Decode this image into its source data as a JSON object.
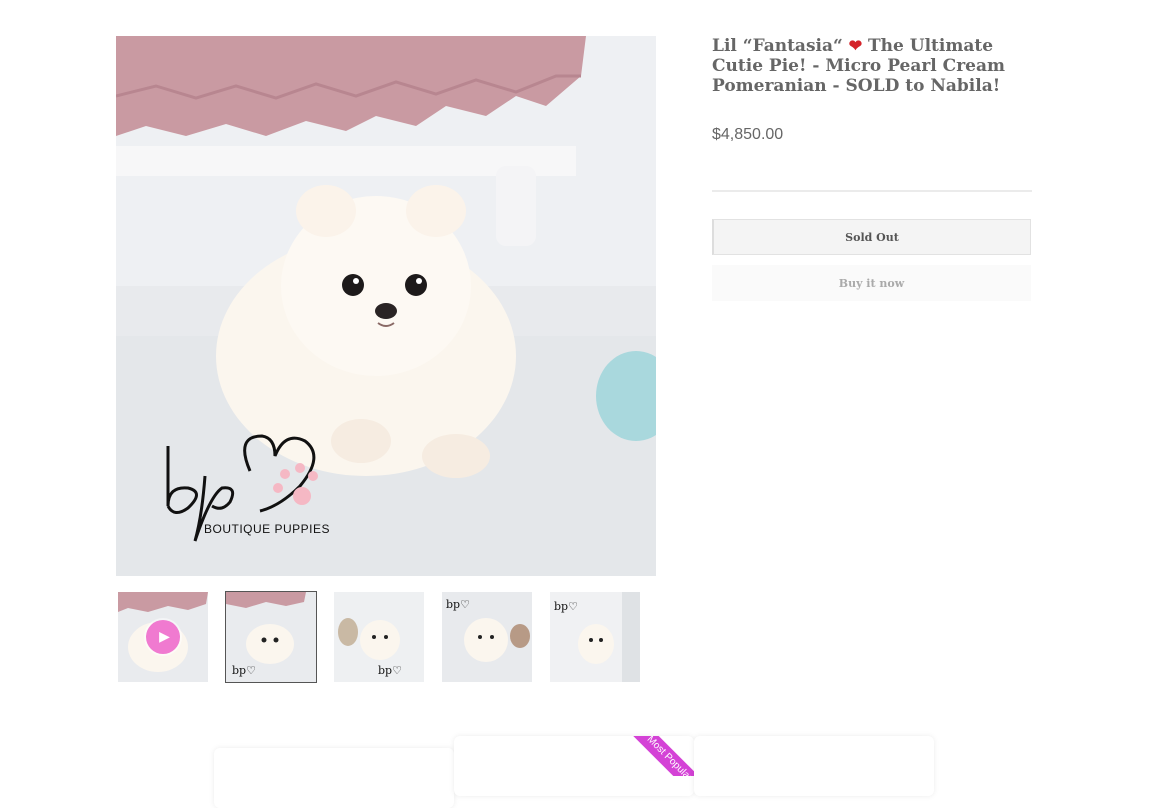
{
  "product": {
    "title": "Lil “Fantasia“ ",
    "title_rest": " The Ultimate Cutie Pie! - Micro Pearl Cream Pomeranian - SOLD to Nabila!",
    "emoji": "heart-emoji",
    "price": "$4,850.00"
  },
  "buttons": {
    "sold_out": "Sold Out",
    "buy_now": "Buy it now"
  },
  "logo": {
    "text": "BOUTIQUE PUPPIES",
    "letters": "bp"
  },
  "thumbnails": [
    {
      "kind": "video",
      "active": false
    },
    {
      "kind": "image",
      "active": true
    },
    {
      "kind": "image",
      "active": false
    },
    {
      "kind": "image",
      "active": false
    },
    {
      "kind": "image",
      "active": false
    }
  ],
  "bottom": {
    "ribbon": "Most Popular"
  },
  "colors": {
    "accent_pink": "#f07ad0",
    "ribbon": "#d442d6",
    "title": "#666666"
  }
}
